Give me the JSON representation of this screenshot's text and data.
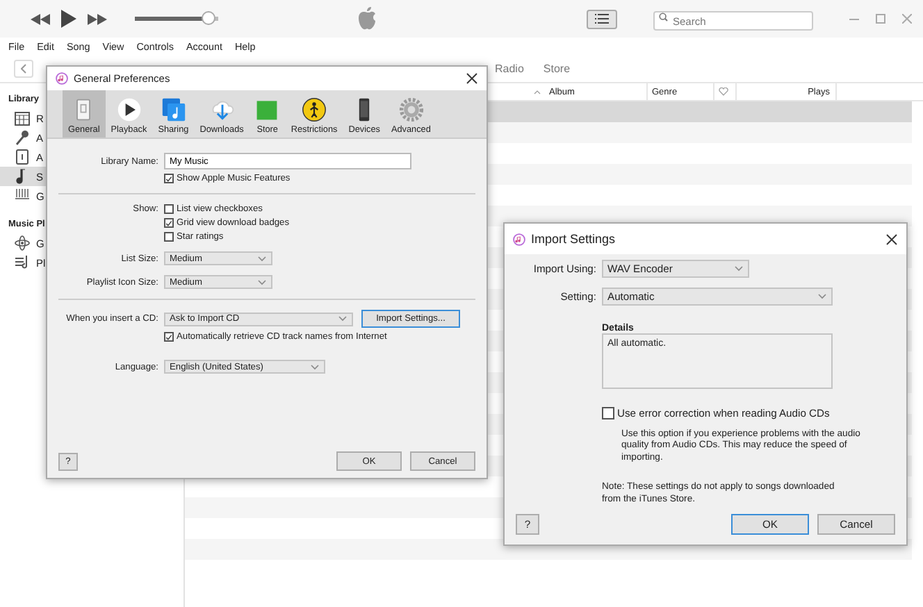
{
  "player": {
    "volume": {
      "level": 0.88
    },
    "search": {
      "placeholder": "Search"
    }
  },
  "menu": [
    "File",
    "Edit",
    "Song",
    "View",
    "Controls",
    "Account",
    "Help"
  ],
  "nav": {
    "tabs": [
      {
        "label": "Radio",
        "selected": false
      },
      {
        "label": "Store",
        "selected": false
      }
    ]
  },
  "sidebar": {
    "sections": [
      {
        "header": "Library",
        "items": [
          {
            "label": "R",
            "selected": false
          },
          {
            "label": "A",
            "selected": false
          },
          {
            "label": "A",
            "selected": false
          },
          {
            "label": "S",
            "selected": true
          },
          {
            "label": "G",
            "selected": false
          }
        ]
      },
      {
        "header": "Music Pl",
        "items": [
          {
            "label": "G",
            "selected": false
          },
          {
            "label": "Pl",
            "selected": false
          }
        ]
      }
    ]
  },
  "table": {
    "columns": [
      {
        "kind": "text",
        "label": "Album",
        "sorted": true
      },
      {
        "kind": "text",
        "label": "Genre",
        "sorted": false
      },
      {
        "kind": "heart",
        "sorted": false
      },
      {
        "kind": "text",
        "label": "Plays",
        "sorted": false
      }
    ],
    "rows": [
      {
        "selected": true
      },
      {
        "selected": false
      },
      {
        "selected": false
      },
      {
        "selected": false
      },
      {
        "selected": false
      },
      {
        "selected": false
      },
      {
        "selected": false
      },
      {
        "selected": false
      },
      {
        "selected": false
      },
      {
        "selected": false
      },
      {
        "selected": false
      },
      {
        "selected": false
      },
      {
        "selected": false
      },
      {
        "selected": false
      },
      {
        "selected": false
      },
      {
        "selected": false
      },
      {
        "selected": false
      },
      {
        "selected": false
      },
      {
        "selected": false
      },
      {
        "selected": false
      },
      {
        "selected": false
      },
      {
        "selected": false
      }
    ]
  },
  "general_preferences": {
    "title": "General Preferences",
    "tabs": [
      {
        "label": "General",
        "selected": true
      },
      {
        "label": "Playback",
        "selected": false
      },
      {
        "label": "Sharing",
        "selected": false
      },
      {
        "label": "Downloads",
        "selected": false
      },
      {
        "label": "Store",
        "selected": false
      },
      {
        "label": "Restrictions",
        "selected": false
      },
      {
        "label": "Devices",
        "selected": false
      },
      {
        "label": "Advanced",
        "selected": false
      }
    ],
    "library_name": {
      "label": "Library Name:",
      "value": "My Music"
    },
    "apple_music": {
      "label": "Show Apple Music Features",
      "checked": true
    },
    "show": {
      "label": "Show:",
      "options": [
        {
          "label": "List view checkboxes",
          "checked": false
        },
        {
          "label": "Grid view download badges",
          "checked": true
        },
        {
          "label": "Star ratings",
          "checked": false
        }
      ]
    },
    "list_size": {
      "label": "List Size:",
      "value": "Medium"
    },
    "playlist_icon_size": {
      "label": "Playlist Icon Size:",
      "value": "Medium"
    },
    "insert_cd": {
      "label": "When you insert a CD:",
      "value": "Ask to Import CD",
      "button": "Import Settings..."
    },
    "retrieve_names": {
      "label": "Automatically retrieve CD track names from Internet",
      "checked": true
    },
    "language": {
      "label": "Language:",
      "value": "English (United States)"
    },
    "help": "?",
    "buttons": [
      "OK",
      "Cancel"
    ]
  },
  "import_settings": {
    "title": "Import Settings",
    "import_using": {
      "label": "Import Using:",
      "value": "WAV Encoder"
    },
    "setting": {
      "label": "Setting:",
      "value": "Automatic"
    },
    "details": {
      "label": "Details",
      "text": "All automatic."
    },
    "error_correction": {
      "label": "Use error correction when reading Audio CDs",
      "checked": false
    },
    "hint": "Use this option if you experience problems with the audio quality from Audio CDs.  This may reduce the speed of importing.",
    "note": "Note: These settings do not apply to songs downloaded from the iTunes Store.",
    "help": "?",
    "buttons": [
      {
        "label": "OK",
        "default": true
      },
      {
        "label": "Cancel",
        "default": false
      }
    ]
  }
}
